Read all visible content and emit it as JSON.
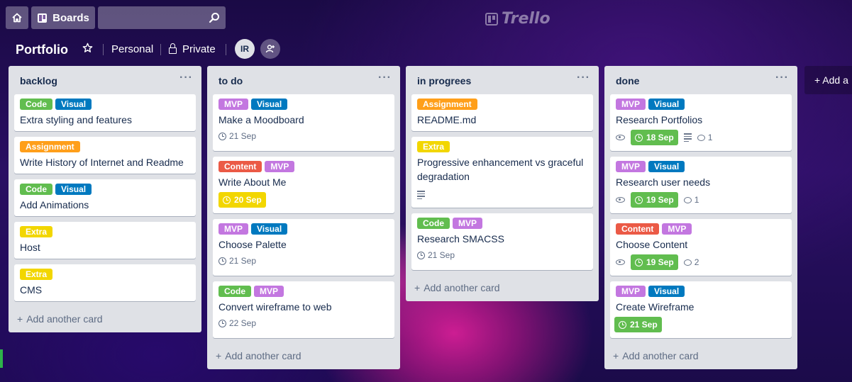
{
  "topbar": {
    "boards_label": "Boards",
    "search_value": "",
    "logo_text": "Trello"
  },
  "board": {
    "title": "Portfolio",
    "team": "Personal",
    "visibility": "Private",
    "member_initials": "IR"
  },
  "colors": {
    "green": "#61bd4f",
    "blue": "#0079bf",
    "purple": "#c377e0",
    "orange": "#ff9f1a",
    "yellow": "#f2d600",
    "red": "#eb5a46",
    "due_complete": "#61bd4f",
    "due_soon": "#f2d600"
  },
  "add_card_label": "Add another card",
  "add_list_label": "Add a",
  "lists": [
    {
      "title": "backlog",
      "cards": [
        {
          "labels": [
            "Code",
            "Visual"
          ],
          "title": "Extra styling and features"
        },
        {
          "labels": [
            "Assignment"
          ],
          "title": "Write History of Internet and Readme"
        },
        {
          "labels": [
            "Code",
            "Visual"
          ],
          "title": "Add Animations"
        },
        {
          "labels": [
            "Extra"
          ],
          "title": "Host"
        },
        {
          "labels": [
            "Extra"
          ],
          "title": "CMS"
        }
      ]
    },
    {
      "title": "to do",
      "cards": [
        {
          "labels": [
            "MVP",
            "Visual"
          ],
          "title": "Make a Moodboard",
          "due": "21 Sep"
        },
        {
          "labels": [
            "Content",
            "MVP"
          ],
          "title": "Write About Me",
          "due": "20 Sep"
        },
        {
          "labels": [
            "MVP",
            "Visual"
          ],
          "title": "Choose Palette",
          "due": "21 Sep"
        },
        {
          "labels": [
            "Code",
            "MVP"
          ],
          "title": "Convert wireframe to web",
          "due": "22 Sep"
        }
      ]
    },
    {
      "title": "in progrees",
      "cards": [
        {
          "labels": [
            "Assignment"
          ],
          "title": "README.md"
        },
        {
          "labels": [
            "Extra"
          ],
          "title_line1": "Progressive enhancement vs graceful",
          "title_line2": "degradation"
        },
        {
          "labels": [
            "Code",
            "MVP"
          ],
          "title": "Research SMACSS",
          "due": "21 Sep"
        }
      ]
    },
    {
      "title": "done",
      "cards": [
        {
          "labels": [
            "MVP",
            "Visual"
          ],
          "title": "Research Portfolios",
          "due": "18 Sep",
          "comments": "1"
        },
        {
          "labels": [
            "MVP",
            "Visual"
          ],
          "title": "Research user needs",
          "due": "19 Sep",
          "comments": "1"
        },
        {
          "labels": [
            "Content",
            "MVP"
          ],
          "title": "Choose Content",
          "due": "19 Sep",
          "comments": "2"
        },
        {
          "labels": [
            "MVP",
            "Visual"
          ],
          "title": "Create Wireframe",
          "due": "21 Sep"
        }
      ]
    }
  ]
}
